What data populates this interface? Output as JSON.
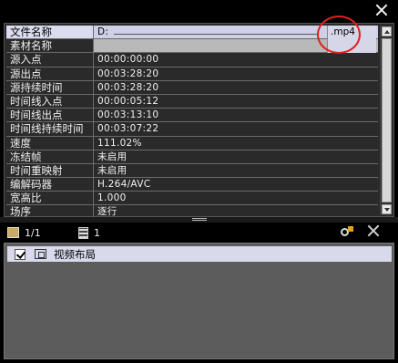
{
  "window": {
    "close_icon": "close-icon"
  },
  "properties": {
    "rows": [
      {
        "key": "文件名称",
        "value": "D:"
      },
      {
        "key": "素材名称",
        "value": ""
      },
      {
        "key": "源入点",
        "value": "00:00:00:00"
      },
      {
        "key": "源出点",
        "value": "00:03:28:20"
      },
      {
        "key": "源持续时间",
        "value": "00:03:28:20"
      },
      {
        "key": "时间线入点",
        "value": "00:00:05:12"
      },
      {
        "key": "时间线出点",
        "value": "00:03:13:10"
      },
      {
        "key": "时间线持续时间",
        "value": "00:03:07:22"
      },
      {
        "key": "速度",
        "value": "111.02%"
      },
      {
        "key": "冻结帧",
        "value": "未启用"
      },
      {
        "key": "时间重映射",
        "value": "未启用"
      },
      {
        "key": "编解码器",
        "value": "H.264/AVC"
      },
      {
        "key": "宽高比",
        "value": "1.000"
      },
      {
        "key": "场序",
        "value": "逐行"
      }
    ],
    "file_extension": ".mp4",
    "annotation_color": "#e0201c"
  },
  "effects_toolbar": {
    "layout_count": "1/1",
    "filter_count": "1",
    "layout_icon": "layout-icon",
    "filter_icon": "filter-icon",
    "add_icon": "add-effect-icon",
    "delete_icon": "delete-icon"
  },
  "effects": {
    "items": [
      {
        "label": "视频布局",
        "checked": true
      }
    ]
  }
}
